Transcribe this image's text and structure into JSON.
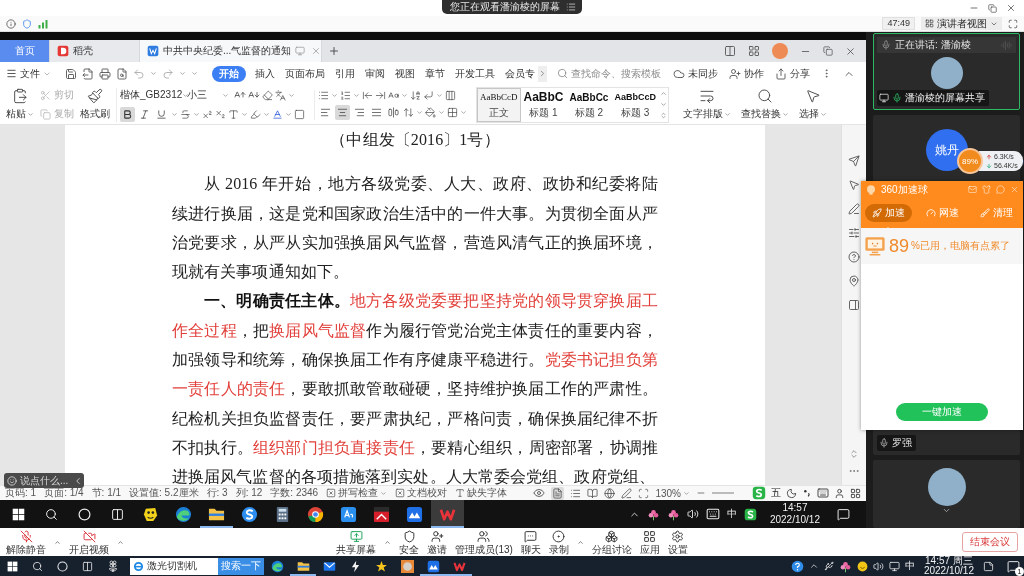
{
  "meeting_header": {
    "viewing_notice": "您正在观看潘渝棱的屏幕",
    "elapsed": "47:49",
    "view_mode": "演讲者视图"
  },
  "wps": {
    "tabs": [
      {
        "kind": "home",
        "label": "首页",
        "selected": false
      },
      {
        "kind": "docer",
        "label": "稻壳",
        "selected": false
      },
      {
        "kind": "document",
        "label": "中共中央纪委...气监督的通知",
        "selected": true
      }
    ],
    "file_menu": "文件",
    "menu_tabs": [
      {
        "label": "开始",
        "selected": true
      },
      {
        "label": "插入",
        "selected": false
      },
      {
        "label": "页面布局",
        "selected": false
      },
      {
        "label": "引用",
        "selected": false
      },
      {
        "label": "审阅",
        "selected": false
      },
      {
        "label": "视图",
        "selected": false
      },
      {
        "label": "章节",
        "selected": false
      },
      {
        "label": "开发工具",
        "selected": false
      },
      {
        "label": "会员专",
        "selected": false
      }
    ],
    "search": {
      "placeholder": "查找命令、搜索模板"
    },
    "top_actions": [
      {
        "kind": "sync",
        "label": "未同步"
      },
      {
        "kind": "collab",
        "label": "协作"
      },
      {
        "kind": "share",
        "label": "分享"
      }
    ],
    "clipboard": [
      {
        "kind": "paste",
        "label": "粘贴",
        "disabled": false
      },
      {
        "kind": "cut",
        "label": "剪切",
        "disabled": true
      },
      {
        "kind": "copy",
        "label": "复制",
        "disabled": true
      },
      {
        "kind": "painter",
        "label": "格式刷",
        "disabled": false
      }
    ],
    "font": {
      "name": "楷体_GB2312",
      "size": "小三"
    },
    "format_toggles": [
      {
        "kind": "bold",
        "on": true
      },
      {
        "kind": "italic",
        "on": false
      },
      {
        "kind": "underline",
        "on": false
      }
    ],
    "alignment": [
      {
        "kind": "left",
        "selected": false
      },
      {
        "kind": "center",
        "selected": true
      },
      {
        "kind": "right",
        "selected": false
      },
      {
        "kind": "justify",
        "selected": false
      },
      {
        "kind": "distributed",
        "selected": false
      }
    ],
    "styles": [
      {
        "sample": "AaBbCcD",
        "label": "正文",
        "selected": true
      },
      {
        "sample": "AaBbC",
        "label": "标题 1",
        "selected": false
      },
      {
        "sample": "AaBbCc",
        "label": "标题 2",
        "selected": false
      },
      {
        "sample": "AaBbCcD",
        "label": "标题 3",
        "selected": false
      }
    ],
    "tools": [
      {
        "kind": "layout",
        "label": "文字排版"
      },
      {
        "kind": "find",
        "label": "查找替换"
      },
      {
        "kind": "select",
        "label": "选择"
      }
    ],
    "document": {
      "doc_number": "（中组发〔2016〕1号）",
      "paragraphs": [
        {
          "runs": [
            {
              "kind": "plain",
              "text": "从 2016 年开始，地方各级党委、人大、政府、政协和纪委将陆续进行换届，这是党和国家政治生活中的一件大事。为贯彻全面从严治党要求，从严从实加强换届风气监督，营造风清气正的换届环境，现就有关事项通知如下。"
            }
          ]
        },
        {
          "runs": [
            {
              "kind": "heading",
              "text": "一、明确责任主体。"
            },
            {
              "kind": "highlight",
              "text": "地方各级党委要把坚持党的领导贯穿换届工作全过程"
            },
            {
              "kind": "plain",
              "text": "，把"
            },
            {
              "kind": "highlight",
              "text": "换届风气监督"
            },
            {
              "kind": "plain",
              "text": "作为履行管党治党主体责任的重要内容，加强领导和统筹，确保换届工作有序健康平稳进行。"
            },
            {
              "kind": "highlight",
              "text": "党委书记担负第一责任人的责任"
            },
            {
              "kind": "plain",
              "text": "，要敢抓敢管敢碰硬，坚持维护换届工作的严肃性。纪检机关担负监督责任，要严肃执纪，严格问责，确保换届纪律不折不扣执行。"
            },
            {
              "kind": "highlight",
              "text": "组织部门担负直接责任"
            },
            {
              "kind": "plain",
              "text": "，要精心组织，周密部署，协调推进换届风气监督的各项措施落到实处。人大常委会党组、政府党组、"
            }
          ]
        }
      ]
    },
    "chat_box": {
      "placeholder": "说点什么..."
    },
    "status_bar": {
      "fields": [
        "页码: 1",
        "页面: 1/4",
        "节: 1/1",
        "设置值: 5.2厘米",
        "行: 3",
        "列: 12",
        "字数: 2346"
      ],
      "checks": [
        {
          "label": "拼写检查",
          "menu": true
        },
        {
          "label": "文档校对",
          "menu": false
        }
      ],
      "missing_font": "缺失字体",
      "zoom": "130%"
    },
    "ime_toolbar": {
      "mode": "五"
    }
  },
  "shared_taskbar": {
    "apps": [
      {
        "kind": "cartoon",
        "active": false,
        "running": false
      },
      {
        "kind": "edge",
        "active": false,
        "running": false
      },
      {
        "kind": "folder",
        "active": false,
        "running": true
      },
      {
        "kind": "sbrowser",
        "active": false,
        "running": false
      },
      {
        "kind": "calculator",
        "active": false,
        "running": false
      },
      {
        "kind": "chrome",
        "active": false,
        "running": false
      },
      {
        "kind": "dict",
        "active": false,
        "running": false
      },
      {
        "kind": "lingo",
        "active": false,
        "running": false
      },
      {
        "kind": "cloud",
        "active": false,
        "running": false
      },
      {
        "kind": "wps",
        "active": true,
        "running": true
      }
    ],
    "ime": "中",
    "time": "14:57",
    "date": "2022/10/12"
  },
  "participants": [
    {
      "kind": "photo",
      "speaking": true,
      "status": "正在讲话: 潘渝棱",
      "name": "潘渝棱的屏幕共享"
    },
    {
      "kind": "initials",
      "speaking": false,
      "initials": "姚丹"
    },
    {
      "kind": "empty",
      "speaking": false,
      "name": "罗强"
    },
    {
      "kind": "photo",
      "speaking": false
    }
  ],
  "speed_ball": {
    "usage": "89%",
    "upload": "6.3K/s",
    "download": "56.4K/s"
  },
  "booster": {
    "title": "360加速球",
    "tabs": [
      {
        "kind": "boost",
        "label": "加速",
        "selected": true
      },
      {
        "kind": "network",
        "label": "网速",
        "selected": false
      },
      {
        "kind": "clean",
        "label": "清理",
        "selected": false
      }
    ],
    "usage": "89",
    "message": "%已用，电脑有点累了",
    "action": "一键加速"
  },
  "meeting_toolbar": {
    "left": [
      {
        "kind": "mic",
        "label": "解除静音",
        "off": true,
        "menu": true
      },
      {
        "kind": "camera",
        "label": "开启视频",
        "off": true,
        "menu": true
      }
    ],
    "center": [
      {
        "kind": "share",
        "label": "共享屏幕",
        "menu": true
      },
      {
        "kind": "security",
        "label": "安全",
        "menu": false
      },
      {
        "kind": "invite",
        "label": "邀请",
        "menu": false
      },
      {
        "kind": "members",
        "label": "管理成员(13)",
        "menu": false
      },
      {
        "kind": "chat",
        "label": "聊天",
        "menu": false
      },
      {
        "kind": "record",
        "label": "录制",
        "menu": true
      },
      {
        "kind": "breakout",
        "label": "分组讨论",
        "menu": false
      },
      {
        "kind": "apps",
        "label": "应用",
        "menu": false
      },
      {
        "kind": "settings",
        "label": "设置",
        "menu": false
      }
    ],
    "end_button": "结束会议"
  },
  "taskbar": {
    "search_value": "激光切割机",
    "search_button": "搜索一下",
    "apps": [
      {
        "kind": "edge",
        "running": false
      },
      {
        "kind": "folder",
        "running": true
      },
      {
        "kind": "mail",
        "running": false
      },
      {
        "kind": "bolt",
        "running": false
      },
      {
        "kind": "emblem",
        "running": false
      },
      {
        "kind": "portrait",
        "running": false
      },
      {
        "kind": "cloud",
        "running": true
      },
      {
        "kind": "wps",
        "running": true
      }
    ],
    "ime": "中",
    "time": "14:57 周三",
    "date": "2022/10/12",
    "notification_count": "1"
  }
}
